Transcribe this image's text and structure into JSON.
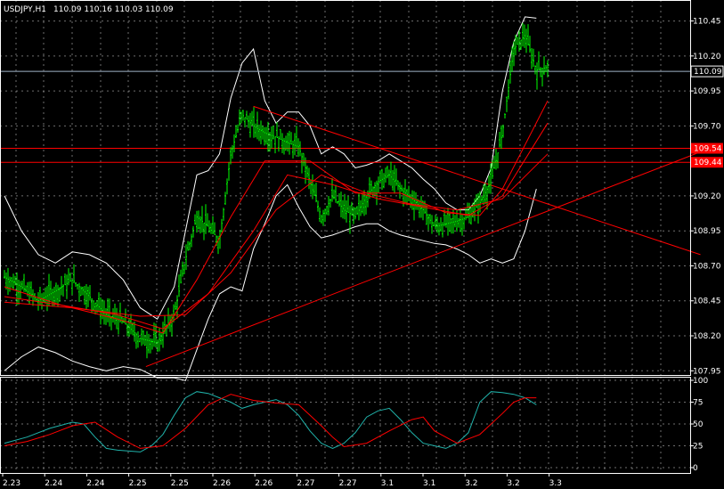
{
  "header": {
    "symbol": "USDJPY,H1",
    "ohlc": "110.09 110.16 110.03 110.09"
  },
  "colors": {
    "background": "#000000",
    "grid": "#c8c8c8",
    "axis": "#ffffff",
    "candle": "#00ff00",
    "ma": "#ff0000",
    "bands": "#ffffff",
    "level_line": "#ff0000",
    "bid_line": "#9fb3c8",
    "stoch_main": "#20b2aa",
    "stoch_signal": "#ff0000"
  },
  "chart_data": [
    {
      "type": "line",
      "title": "USDJPY,H1",
      "x_ticks": [
        "2.23",
        "2.24",
        "2.24",
        "2.25",
        "2.25",
        "2.26",
        "2.26",
        "2.27",
        "2.27",
        "3.1",
        "3.1",
        "3.2",
        "3.2",
        "3.3"
      ],
      "y_ticks": [
        "110.45",
        "110.20",
        "109.95",
        "109.70",
        "109.20",
        "108.95",
        "108.70",
        "108.45",
        "108.20",
        "107.95"
      ],
      "ylim": [
        107.92,
        110.6
      ],
      "grid": true,
      "current_price": "110.09",
      "horizontal_levels": [
        {
          "label": "109.54",
          "value": 109.54
        },
        {
          "label": "109.44",
          "value": 109.44
        }
      ],
      "trendlines": [
        {
          "name": "resistance",
          "from": [
            44,
            109.84
          ],
          "to": [
            123,
            108.78
          ]
        },
        {
          "name": "support",
          "from": [
            25,
            107.98
          ],
          "to": [
            124,
            109.53
          ]
        }
      ],
      "price_path": [
        [
          0,
          108.62
        ],
        [
          3,
          108.55
        ],
        [
          6,
          108.45
        ],
        [
          9,
          108.52
        ],
        [
          12,
          108.6
        ],
        [
          15,
          108.48
        ],
        [
          18,
          108.35
        ],
        [
          21,
          108.3
        ],
        [
          24,
          108.18
        ],
        [
          27,
          108.15
        ],
        [
          30,
          108.35
        ],
        [
          32,
          108.75
        ],
        [
          34,
          109.05
        ],
        [
          36,
          108.98
        ],
        [
          38,
          108.88
        ],
        [
          40,
          109.5
        ],
        [
          42,
          109.78
        ],
        [
          44,
          109.7
        ],
        [
          46,
          109.65
        ],
        [
          48,
          109.62
        ],
        [
          50,
          109.58
        ],
        [
          52,
          109.55
        ],
        [
          54,
          109.3
        ],
        [
          56,
          109.05
        ],
        [
          58,
          109.2
        ],
        [
          60,
          109.1
        ],
        [
          62,
          109.05
        ],
        [
          64,
          109.2
        ],
        [
          66,
          109.3
        ],
        [
          68,
          109.35
        ],
        [
          70,
          109.25
        ],
        [
          72,
          109.18
        ],
        [
          74,
          109.1
        ],
        [
          76,
          108.98
        ],
        [
          78,
          109.0
        ],
        [
          80,
          109.02
        ],
        [
          82,
          109.05
        ],
        [
          84,
          109.15
        ],
        [
          86,
          109.3
        ],
        [
          88,
          109.65
        ],
        [
          90,
          110.25
        ],
        [
          92,
          110.35
        ],
        [
          94,
          110.1
        ],
        [
          96,
          110.12
        ]
      ],
      "moving_averages": [
        {
          "values": [
            [
              0,
              108.55
            ],
            [
              10,
              108.42
            ],
            [
              20,
              108.32
            ],
            [
              28,
              108.22
            ],
            [
              34,
              108.6
            ],
            [
              40,
              109.05
            ],
            [
              46,
              109.45
            ],
            [
              54,
              109.45
            ],
            [
              62,
              109.22
            ],
            [
              70,
              109.22
            ],
            [
              78,
              109.08
            ],
            [
              84,
              109.06
            ],
            [
              88,
              109.25
            ],
            [
              96,
              109.88
            ]
          ]
        },
        {
          "values": [
            [
              0,
              108.48
            ],
            [
              10,
              108.42
            ],
            [
              20,
              108.35
            ],
            [
              28,
              108.25
            ],
            [
              36,
              108.5
            ],
            [
              44,
              108.95
            ],
            [
              50,
              109.35
            ],
            [
              58,
              109.28
            ],
            [
              66,
              109.18
            ],
            [
              74,
              109.12
            ],
            [
              82,
              109.06
            ],
            [
              88,
              109.2
            ],
            [
              96,
              109.72
            ]
          ]
        },
        {
          "values": [
            [
              0,
              108.44
            ],
            [
              12,
              108.4
            ],
            [
              24,
              108.34
            ],
            [
              32,
              108.35
            ],
            [
              40,
              108.65
            ],
            [
              48,
              109.1
            ],
            [
              56,
              109.35
            ],
            [
              64,
              109.22
            ],
            [
              72,
              109.14
            ],
            [
              80,
              109.1
            ],
            [
              88,
              109.18
            ],
            [
              96,
              109.5
            ]
          ]
        }
      ],
      "bands": {
        "upper": [
          [
            0,
            109.2
          ],
          [
            3,
            108.95
          ],
          [
            6,
            108.78
          ],
          [
            9,
            108.72
          ],
          [
            12,
            108.8
          ],
          [
            15,
            108.78
          ],
          [
            18,
            108.72
          ],
          [
            21,
            108.6
          ],
          [
            24,
            108.4
          ],
          [
            27,
            108.32
          ],
          [
            30,
            108.55
          ],
          [
            32,
            108.95
          ],
          [
            34,
            109.35
          ],
          [
            36,
            109.38
          ],
          [
            38,
            109.5
          ],
          [
            40,
            109.9
          ],
          [
            42,
            110.15
          ],
          [
            44,
            110.25
          ],
          [
            46,
            109.88
          ],
          [
            48,
            109.72
          ],
          [
            50,
            109.8
          ],
          [
            52,
            109.8
          ],
          [
            54,
            109.7
          ],
          [
            56,
            109.5
          ],
          [
            58,
            109.55
          ],
          [
            60,
            109.5
          ],
          [
            62,
            109.4
          ],
          [
            64,
            109.42
          ],
          [
            66,
            109.45
          ],
          [
            68,
            109.5
          ],
          [
            70,
            109.45
          ],
          [
            72,
            109.4
          ],
          [
            74,
            109.32
          ],
          [
            76,
            109.25
          ],
          [
            78,
            109.15
          ],
          [
            80,
            109.1
          ],
          [
            82,
            109.1
          ],
          [
            84,
            109.2
          ],
          [
            86,
            109.4
          ],
          [
            88,
            109.95
          ],
          [
            90,
            110.3
          ],
          [
            92,
            110.48
          ],
          [
            94,
            110.47
          ]
        ],
        "lower": [
          [
            0,
            107.95
          ],
          [
            3,
            108.05
          ],
          [
            6,
            108.12
          ],
          [
            9,
            108.08
          ],
          [
            12,
            108.02
          ],
          [
            15,
            107.98
          ],
          [
            18,
            107.95
          ],
          [
            21,
            107.98
          ],
          [
            24,
            107.96
          ],
          [
            27,
            107.9
          ],
          [
            30,
            107.9
          ],
          [
            32,
            107.88
          ],
          [
            34,
            108.1
          ],
          [
            36,
            108.32
          ],
          [
            38,
            108.5
          ],
          [
            40,
            108.55
          ],
          [
            42,
            108.52
          ],
          [
            44,
            108.82
          ],
          [
            46,
            109.0
          ],
          [
            48,
            109.2
          ],
          [
            50,
            109.28
          ],
          [
            52,
            109.12
          ],
          [
            54,
            108.98
          ],
          [
            56,
            108.9
          ],
          [
            58,
            108.92
          ],
          [
            60,
            108.95
          ],
          [
            62,
            108.98
          ],
          [
            64,
            109.0
          ],
          [
            66,
            109.0
          ],
          [
            68,
            108.95
          ],
          [
            70,
            108.92
          ],
          [
            72,
            108.9
          ],
          [
            74,
            108.88
          ],
          [
            76,
            108.86
          ],
          [
            78,
            108.85
          ],
          [
            80,
            108.82
          ],
          [
            82,
            108.78
          ],
          [
            84,
            108.72
          ],
          [
            86,
            108.75
          ],
          [
            88,
            108.72
          ],
          [
            90,
            108.75
          ],
          [
            92,
            108.95
          ],
          [
            94,
            109.25
          ]
        ]
      }
    },
    {
      "type": "line",
      "y_ticks": [
        "100",
        "75",
        "50",
        "25",
        "0"
      ],
      "ylim": [
        0,
        100
      ],
      "series": [
        {
          "values": [
            [
              0,
              28
            ],
            [
              4,
              35
            ],
            [
              8,
              45
            ],
            [
              12,
              52
            ],
            [
              14,
              50
            ],
            [
              16,
              35
            ],
            [
              18,
              22
            ],
            [
              20,
              20
            ],
            [
              24,
              18
            ],
            [
              26,
              25
            ],
            [
              28,
              38
            ],
            [
              30,
              60
            ],
            [
              32,
              80
            ],
            [
              34,
              87
            ],
            [
              36,
              85
            ],
            [
              38,
              80
            ],
            [
              40,
              75
            ],
            [
              42,
              68
            ],
            [
              44,
              72
            ],
            [
              46,
              75
            ],
            [
              48,
              78
            ],
            [
              50,
              72
            ],
            [
              52,
              60
            ],
            [
              54,
              42
            ],
            [
              56,
              28
            ],
            [
              58,
              22
            ],
            [
              60,
              28
            ],
            [
              62,
              40
            ],
            [
              64,
              58
            ],
            [
              66,
              65
            ],
            [
              68,
              68
            ],
            [
              70,
              55
            ],
            [
              72,
              40
            ],
            [
              74,
              28
            ],
            [
              76,
              25
            ],
            [
              78,
              22
            ],
            [
              80,
              28
            ],
            [
              82,
              40
            ],
            [
              84,
              75
            ],
            [
              86,
              87
            ],
            [
              88,
              86
            ],
            [
              90,
              84
            ],
            [
              92,
              80
            ],
            [
              94,
              72
            ]
          ]
        },
        {
          "values": [
            [
              0,
              25
            ],
            [
              4,
              30
            ],
            [
              8,
              38
            ],
            [
              12,
              48
            ],
            [
              16,
              52
            ],
            [
              20,
              35
            ],
            [
              24,
              22
            ],
            [
              28,
              25
            ],
            [
              32,
              45
            ],
            [
              36,
              72
            ],
            [
              40,
              84
            ],
            [
              44,
              77
            ],
            [
              48,
              74
            ],
            [
              52,
              72
            ],
            [
              56,
              48
            ],
            [
              58,
              35
            ],
            [
              60,
              24
            ],
            [
              64,
              28
            ],
            [
              68,
              42
            ],
            [
              72,
              55
            ],
            [
              74,
              58
            ],
            [
              76,
              42
            ],
            [
              80,
              28
            ],
            [
              84,
              38
            ],
            [
              88,
              62
            ],
            [
              90,
              75
            ],
            [
              92,
              80
            ],
            [
              94,
              80
            ]
          ]
        }
      ]
    }
  ]
}
